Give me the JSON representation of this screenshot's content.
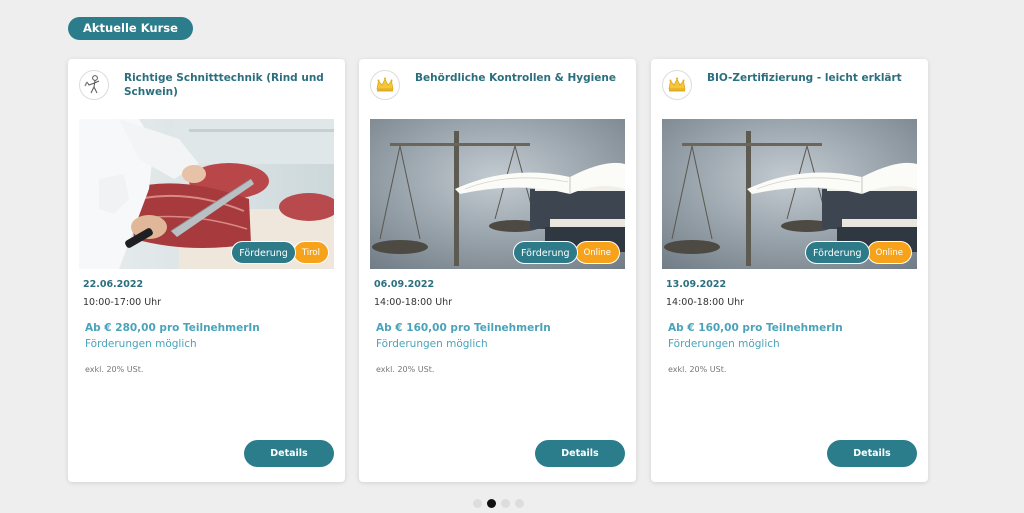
{
  "section": {
    "title": "Aktuelle Kurse"
  },
  "courses": [
    {
      "title": "Richtige Schnitttechnik (Rind und Schwein)",
      "logo": "butcher-figure-icon",
      "image": "meat-cutting-photo",
      "badge_funding": "Förderung",
      "badge_region": "Tirol",
      "date": "22.06.2022",
      "time": "10:00-17:00 Uhr",
      "price": "Ab € 280,00 pro TeilnehmerIn",
      "funding_note": "Förderungen möglich",
      "vat_note": "exkl. 20% USt.",
      "details_label": "Details"
    },
    {
      "title": "Behördliche Kontrollen & Hygiene",
      "logo": "crown-icon",
      "image": "scales-and-books-photo",
      "badge_funding": "Förderung",
      "badge_region": "Online",
      "date": "06.09.2022",
      "time": "14:00-18:00 Uhr",
      "price": "Ab € 160,00 pro TeilnehmerIn",
      "funding_note": "Förderungen möglich",
      "vat_note": "exkl. 20% USt.",
      "details_label": "Details"
    },
    {
      "title": "BIO-Zertifizierung - leicht erklärt",
      "logo": "crown-icon",
      "image": "scales-and-books-photo",
      "badge_funding": "Förderung",
      "badge_region": "Online",
      "date": "13.09.2022",
      "time": "14:00-18:00 Uhr",
      "price": "Ab € 160,00 pro TeilnehmerIn",
      "funding_note": "Förderungen möglich",
      "vat_note": "exkl. 20% USt.",
      "details_label": "Details"
    }
  ],
  "carousel": {
    "page_count": 4,
    "active_page": 2
  },
  "colors": {
    "primary": "#2b7d8c",
    "title_text": "#2b6f7e",
    "price_text": "#4aa3ba",
    "badge_region": "#f7a21b",
    "background": "#eeeeee"
  }
}
